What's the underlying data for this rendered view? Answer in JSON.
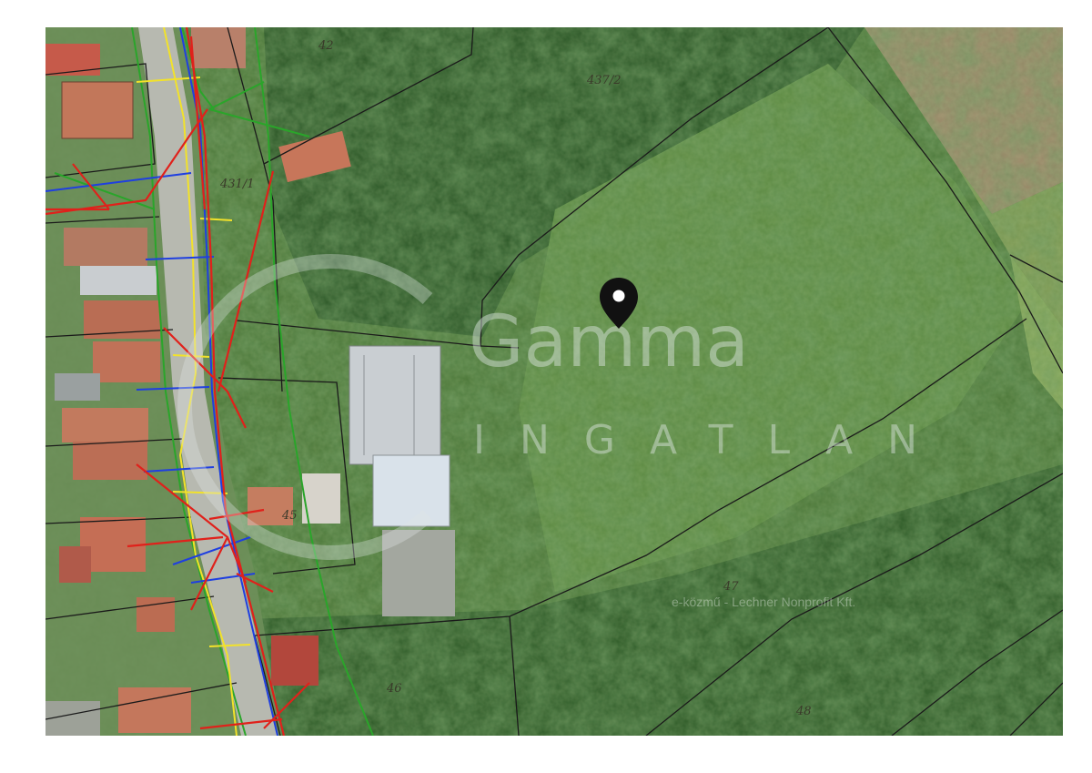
{
  "map": {
    "type": "satellite-cadastral",
    "watermark": {
      "brand": "Gamma",
      "subtitle": "INGATLAN"
    },
    "attribution": "e-közmű - Lechner Nonprofit Kft.",
    "marker_icon": "map-pin-icon",
    "parcel_labels": {
      "p42": "42",
      "p437": "437/2",
      "p431": "431/1",
      "p45": "45",
      "p46": "46",
      "p47": "47",
      "p48": "48"
    },
    "utility_line_colors": {
      "red": "#e0211b",
      "yellow": "#f2e22a",
      "blue": "#1f3fe0",
      "green": "#2aa52a",
      "parcel_boundary": "#1a1a1a"
    }
  }
}
